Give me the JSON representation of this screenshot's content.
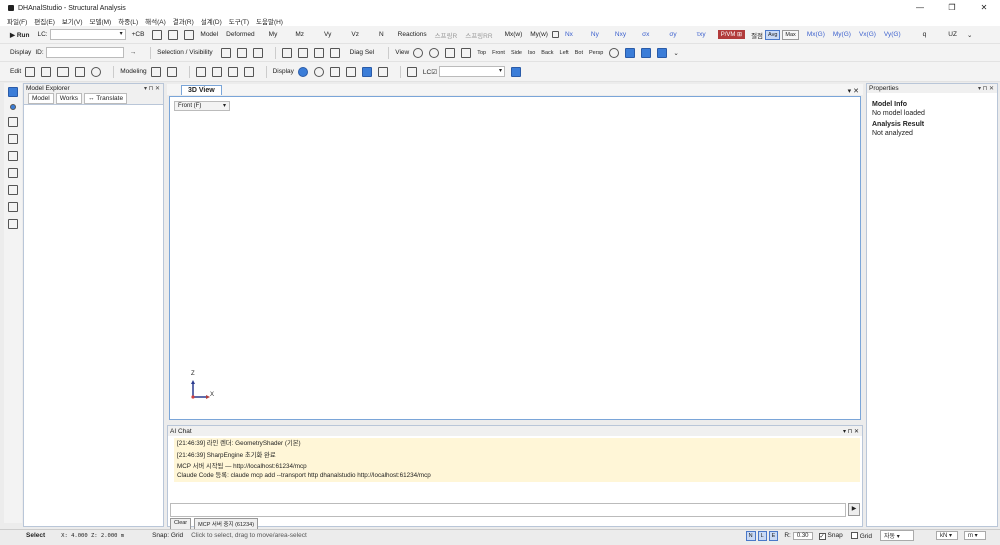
{
  "window": {
    "title": "DHAnalStudio - Structural Analysis",
    "minimize": "—",
    "maximize": "❐",
    "close": "✕"
  },
  "menu": [
    "파일(F)",
    "편집(E)",
    "보기(V)",
    "모델(M)",
    "하중(L)",
    "해석(A)",
    "결과(R)",
    "설계(D)",
    "도구(T)",
    "도움말(H)"
  ],
  "toolbar1": {
    "run": "Run",
    "lc_label": "LC:",
    "cb": "+CB",
    "items": [
      "Model",
      "Deformed",
      "My",
      "Mz",
      "Vy",
      "Vz",
      "N",
      "Reactions"
    ],
    "grey_items": [
      "스프링R",
      "스프링RR"
    ],
    "items2": [
      "Mx(w)",
      "My(w)"
    ],
    "blue_items": [
      "Nx",
      "Ny",
      "Nxy",
      "σx",
      "σy",
      "τxy"
    ],
    "pvm": "P/VM ⊞",
    "surface_label": "절점",
    "avg": "Avg",
    "max": "Max",
    "blue_items2": [
      "Mx(G)",
      "My(G)",
      "Vx(G)",
      "Vy(G)"
    ],
    "items3": [
      "q",
      "UZ"
    ]
  },
  "toolbar2": {
    "display_label": "Display",
    "id_label": "ID:",
    "arrow": "→",
    "selection_label": "Selection / Visibility",
    "diag_sel": "Diag Sel",
    "view_label": "View",
    "views": [
      "Top",
      "Front",
      "Side",
      "Iso",
      "Back",
      "Left",
      "Bot",
      "Persp"
    ]
  },
  "toolbar3": {
    "edit_label": "Edit",
    "modeling_label": "Modeling",
    "display_label": "Display",
    "lc_label": "LC☑"
  },
  "explorer": {
    "title": "Model Explorer",
    "tabs": [
      "Model",
      "Works",
      "↔ Translate"
    ]
  },
  "view": {
    "tab": "3D View",
    "view_select": "Front (F)",
    "axis_z": "Z",
    "axis_x": "X"
  },
  "properties": {
    "title": "Properties",
    "model_info_h": "Model Info",
    "model_info_v": "No model loaded",
    "analysis_h": "Analysis Result",
    "analysis_v": "Not analyzed"
  },
  "aichat": {
    "title": "AI Chat",
    "log": [
      "[21:46:39] 라인 렌더: GeometryShader (기본)",
      "[21:46:39] SharpEngine 초기화 완료",
      "MCP 서버 시작됨 — http://localhost:61234/mcp",
      "Claude Code 등록: claude mcp add --transport http dhanalstudio http://localhost:61234/mcp"
    ],
    "send": "▶",
    "clear": "Clear",
    "mcp_stop": "MCP 서버 중지 (61234)"
  },
  "status": {
    "mode": "Select",
    "coords": "X: 4.000  Z: 2.000 m",
    "snap_grid": "Snap: Grid",
    "hint": "Click to select, drag to move/area-select",
    "r_label": "R:",
    "r_value": "0.30",
    "snap": "Snap",
    "grid": "Grid",
    "lang": "자동",
    "unit_force": "kN",
    "unit_len": "m"
  }
}
